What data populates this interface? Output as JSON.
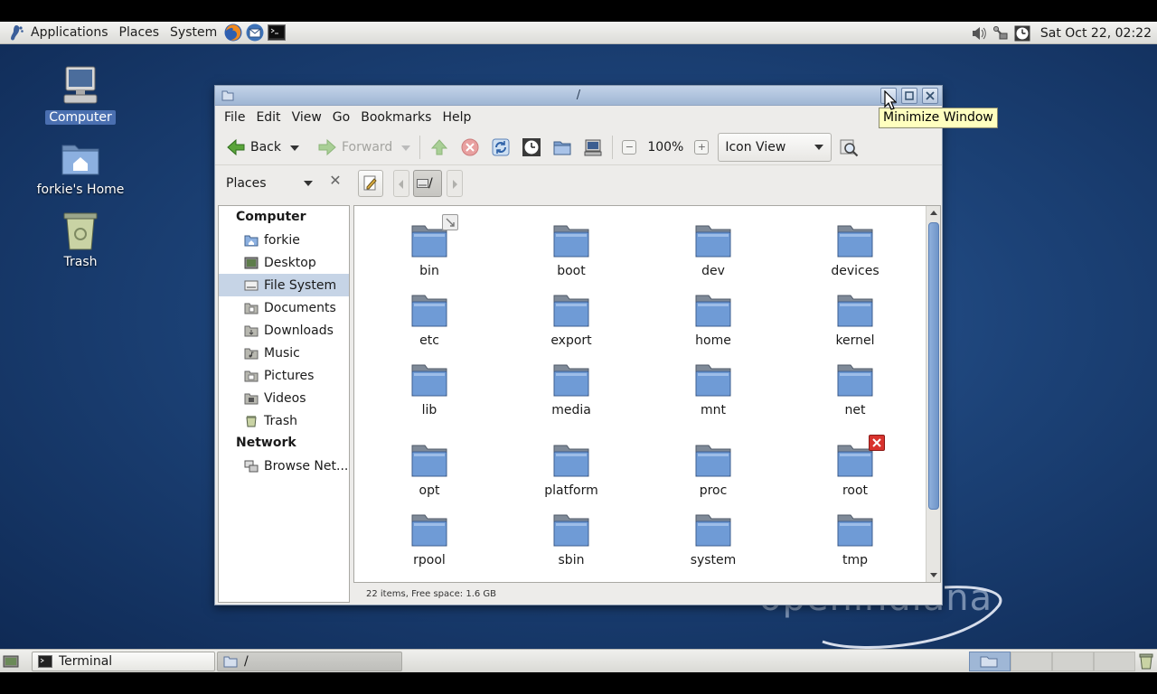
{
  "top_panel": {
    "menus": [
      "Applications",
      "Places",
      "System"
    ],
    "clock": "Sat Oct 22, 02:22"
  },
  "desktop": {
    "icons": [
      {
        "label": "Computer"
      },
      {
        "label": "forkie's Home"
      },
      {
        "label": "Trash"
      }
    ],
    "brand": "openindiana"
  },
  "window": {
    "title": "/",
    "menus": [
      "File",
      "Edit",
      "View",
      "Go",
      "Bookmarks",
      "Help"
    ],
    "toolbar": {
      "back": "Back",
      "forward": "Forward",
      "zoom": "100%",
      "view_mode": "Icon View"
    },
    "location": {
      "places_label": "Places",
      "path_root": "/"
    },
    "sidebar": {
      "computer_heading": "Computer",
      "computer_items": [
        "forkie",
        "Desktop",
        "File System",
        "Documents",
        "Downloads",
        "Music",
        "Pictures",
        "Videos",
        "Trash"
      ],
      "selected": "File System",
      "network_heading": "Network",
      "network_items": [
        "Browse Net..."
      ]
    },
    "files": [
      "bin",
      "boot",
      "dev",
      "devices",
      "etc",
      "export",
      "home",
      "kernel",
      "lib",
      "media",
      "mnt",
      "net",
      "opt",
      "platform",
      "proc",
      "root",
      "rpool",
      "sbin",
      "system",
      "tmp"
    ],
    "status": "22 items, Free space: 1.6 GB"
  },
  "tooltip": "Minimize Window",
  "bottom_panel": {
    "tasks": [
      "Terminal",
      "/"
    ]
  },
  "colors": {
    "accent": "#c6d4e6",
    "desktop_bg": "#1c4277",
    "folder": "#6f9bd6"
  }
}
